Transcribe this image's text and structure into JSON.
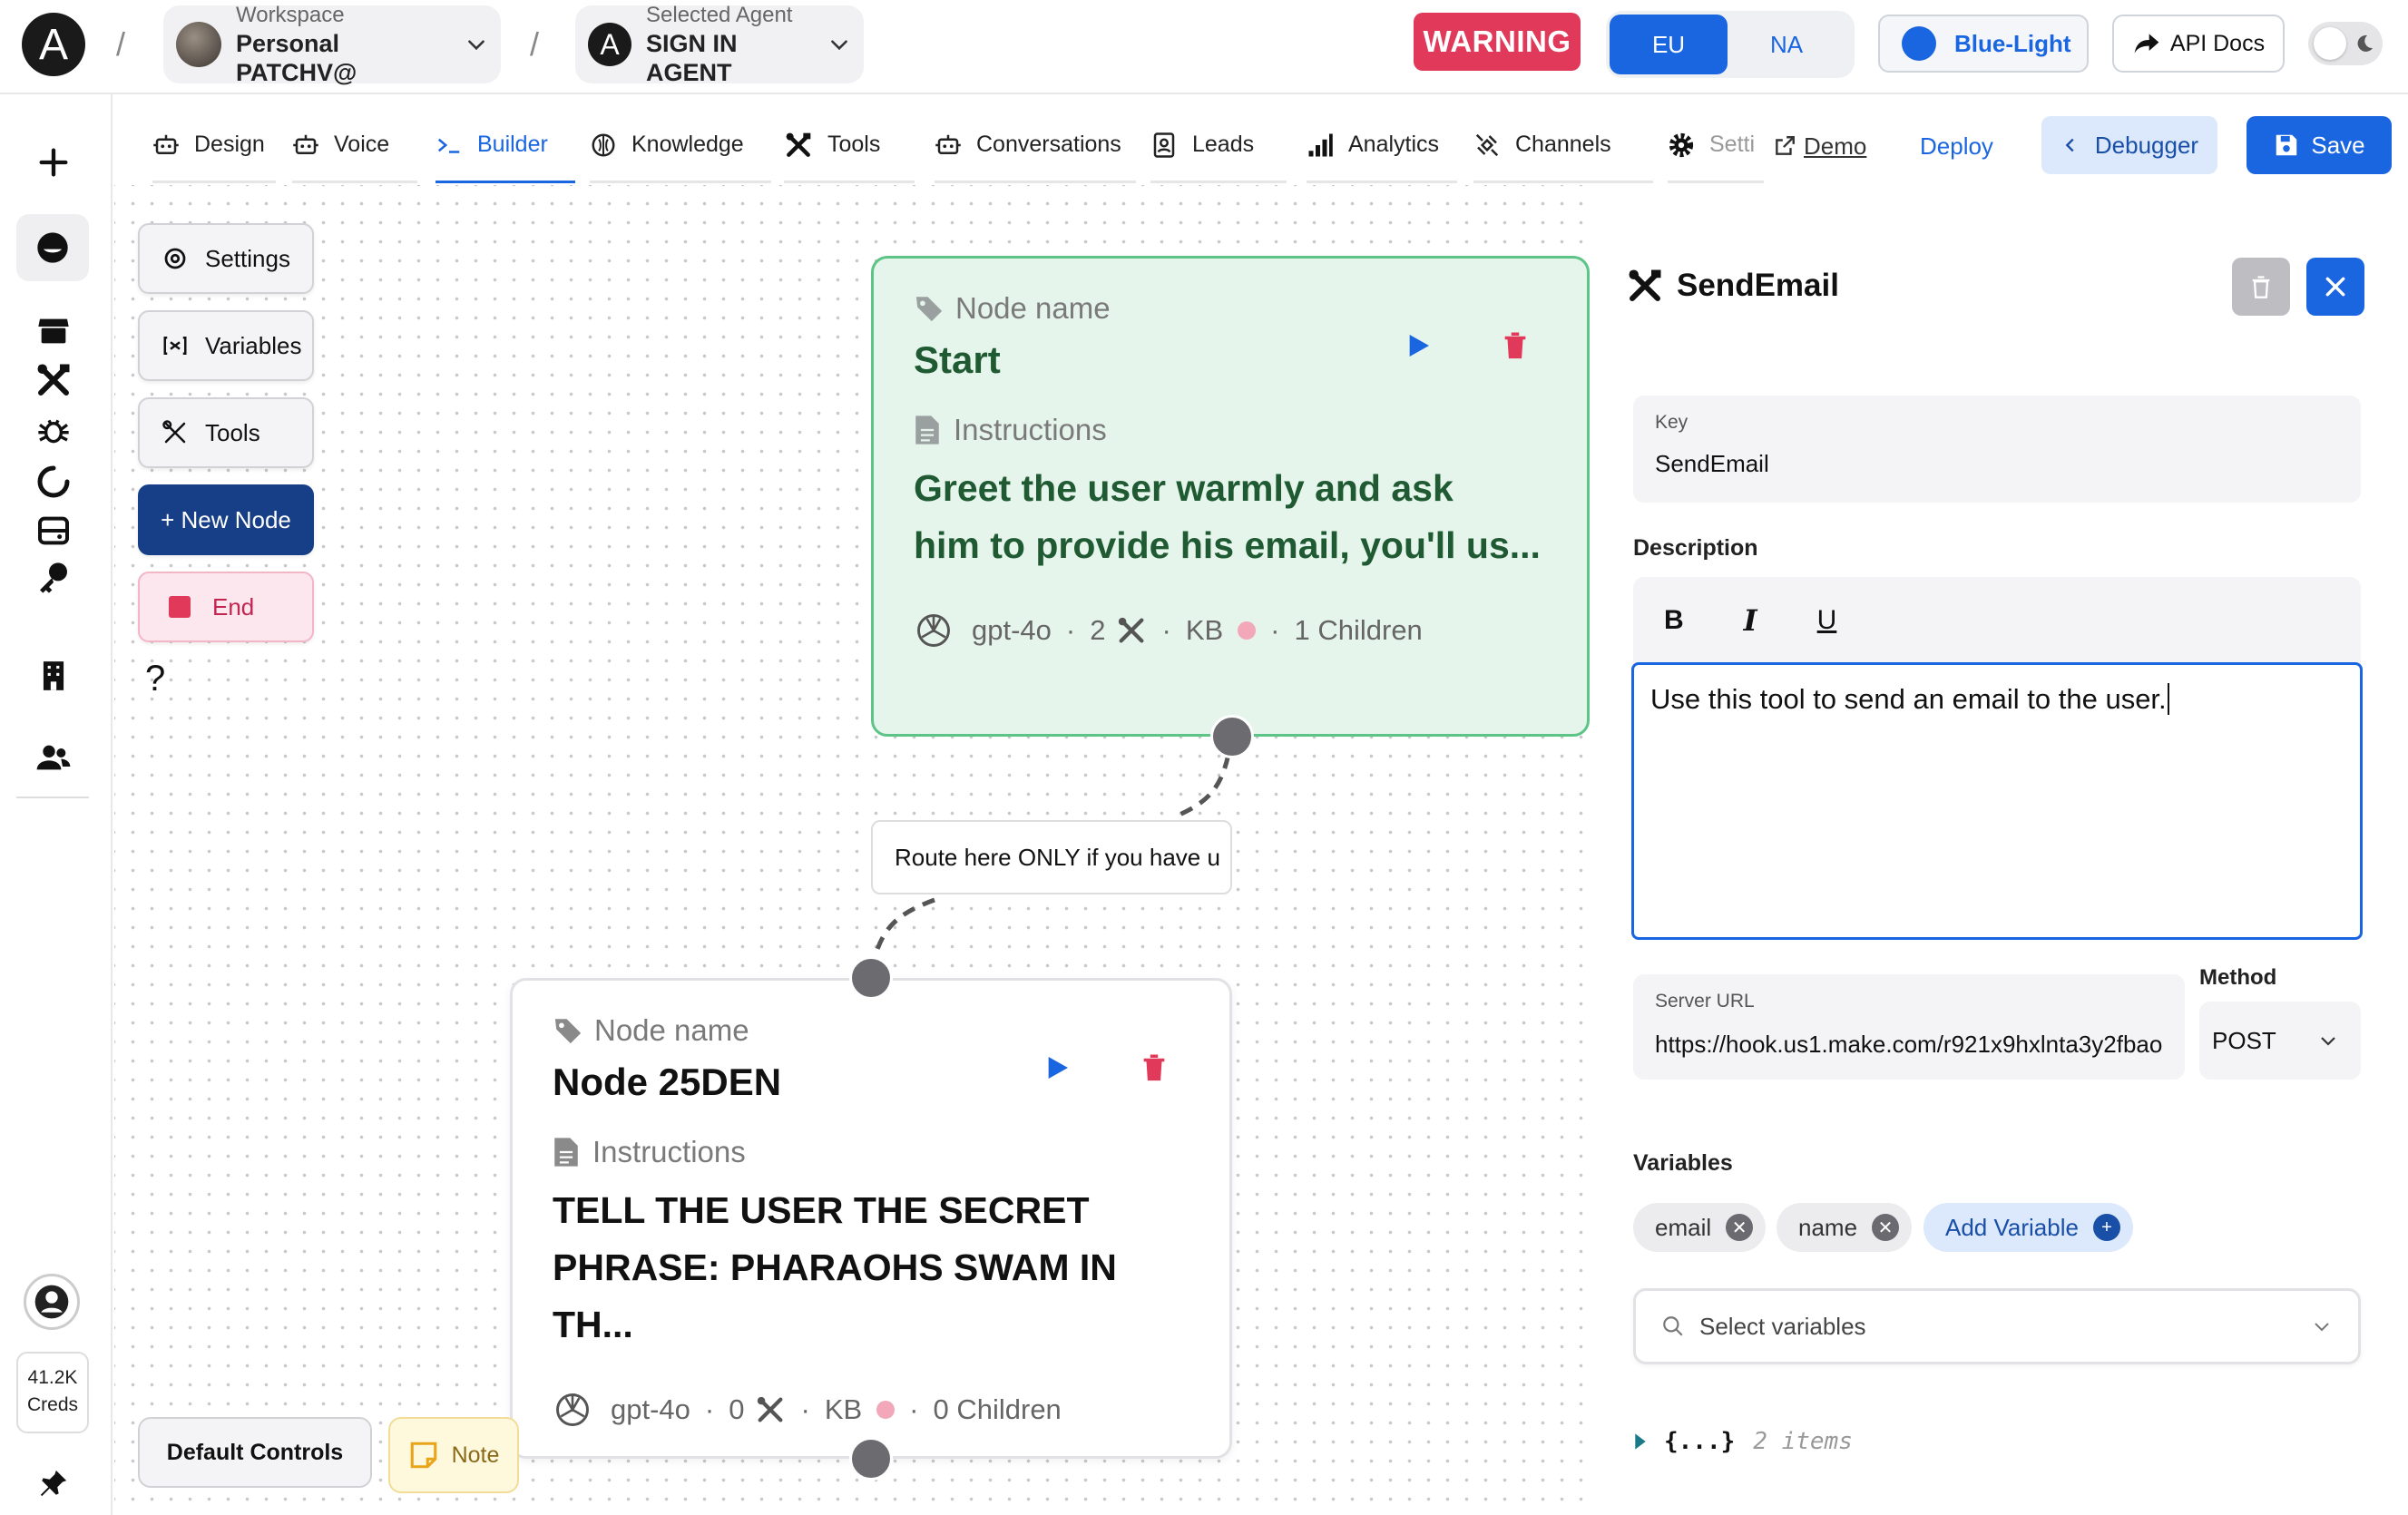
{
  "topbar": {
    "logo": "A",
    "workspace_label": "Workspace",
    "workspace_value": "Personal PATCHV@",
    "agent_label": "Selected Agent",
    "agent_value": "SIGN IN AGENT",
    "agent_logo": "A",
    "warning": "WARNING",
    "region_eu": "EU",
    "region_na": "NA",
    "theme": "Blue-Light",
    "api_docs": "API Docs"
  },
  "tabs": [
    {
      "label": "Design",
      "icon": "robot-icon"
    },
    {
      "label": "Voice",
      "icon": "robot-icon"
    },
    {
      "label": "Builder",
      "icon": "terminal-icon",
      "active": true
    },
    {
      "label": "Knowledge",
      "icon": "brain-icon"
    },
    {
      "label": "Tools",
      "icon": "tools-icon"
    },
    {
      "label": "Conversations",
      "icon": "robot-icon"
    },
    {
      "label": "Leads",
      "icon": "contact-icon"
    },
    {
      "label": "Analytics",
      "icon": "bar-chart-icon"
    },
    {
      "label": "Channels",
      "icon": "satellite-icon"
    },
    {
      "label": "Setti",
      "icon": "gear-icon"
    }
  ],
  "actions": {
    "demo": "Demo",
    "deploy": "Deploy",
    "debugger": "Debugger",
    "save": "Save"
  },
  "rail": {
    "creds_value": "41.2K",
    "creds_label": "Creds"
  },
  "canvas": {
    "controls": {
      "settings": "Settings",
      "variables": "Variables",
      "tools": "Tools",
      "new_node": "+ New Node",
      "end": "End",
      "help": "?"
    },
    "default_controls": "Default Controls",
    "note": "Note",
    "edge_label": "Route here ONLY if you have u",
    "nodes": [
      {
        "name_label": "Node name",
        "title": "Start",
        "instr_label": "Instructions",
        "instr_line1": "Greet the user warmly and ask",
        "instr_line2": "him to provide his email, you'll us...",
        "model": "gpt-4o",
        "tools": "2",
        "kb": "KB",
        "children": "1 Children"
      },
      {
        "name_label": "Node name",
        "title": "Node 25DEN",
        "instr_label": "Instructions",
        "instr_line1": "TELL THE USER THE SECRET",
        "instr_line2": "PHRASE: PHARAOHS SWAM IN TH...",
        "model": "gpt-4o",
        "tools": "0",
        "kb": "KB",
        "children": "0 Children"
      }
    ]
  },
  "panel": {
    "title": "SendEmail",
    "key_label": "Key",
    "key_value": "SendEmail",
    "description_label": "Description",
    "description_text": "Use this tool to send an email to the user.",
    "server_url_label": "Server URL",
    "server_url_value": "https://hook.us1.make.com/r921x9hxlnta3y2fbao",
    "method_label": "Method",
    "method_value": "POST",
    "variables_label": "Variables",
    "variables": [
      "email",
      "name"
    ],
    "add_variable": "Add Variable",
    "select_placeholder": "Select variables",
    "json_preview": "{...}",
    "json_count": "2 items"
  },
  "colors": {
    "accent": "#1a66e0",
    "warning": "#e0395a",
    "start_node_bg": "#e6f5ec",
    "start_node_border": "#5cc486",
    "node_text_green": "#1f5a32",
    "end_red": "#e0395a"
  }
}
